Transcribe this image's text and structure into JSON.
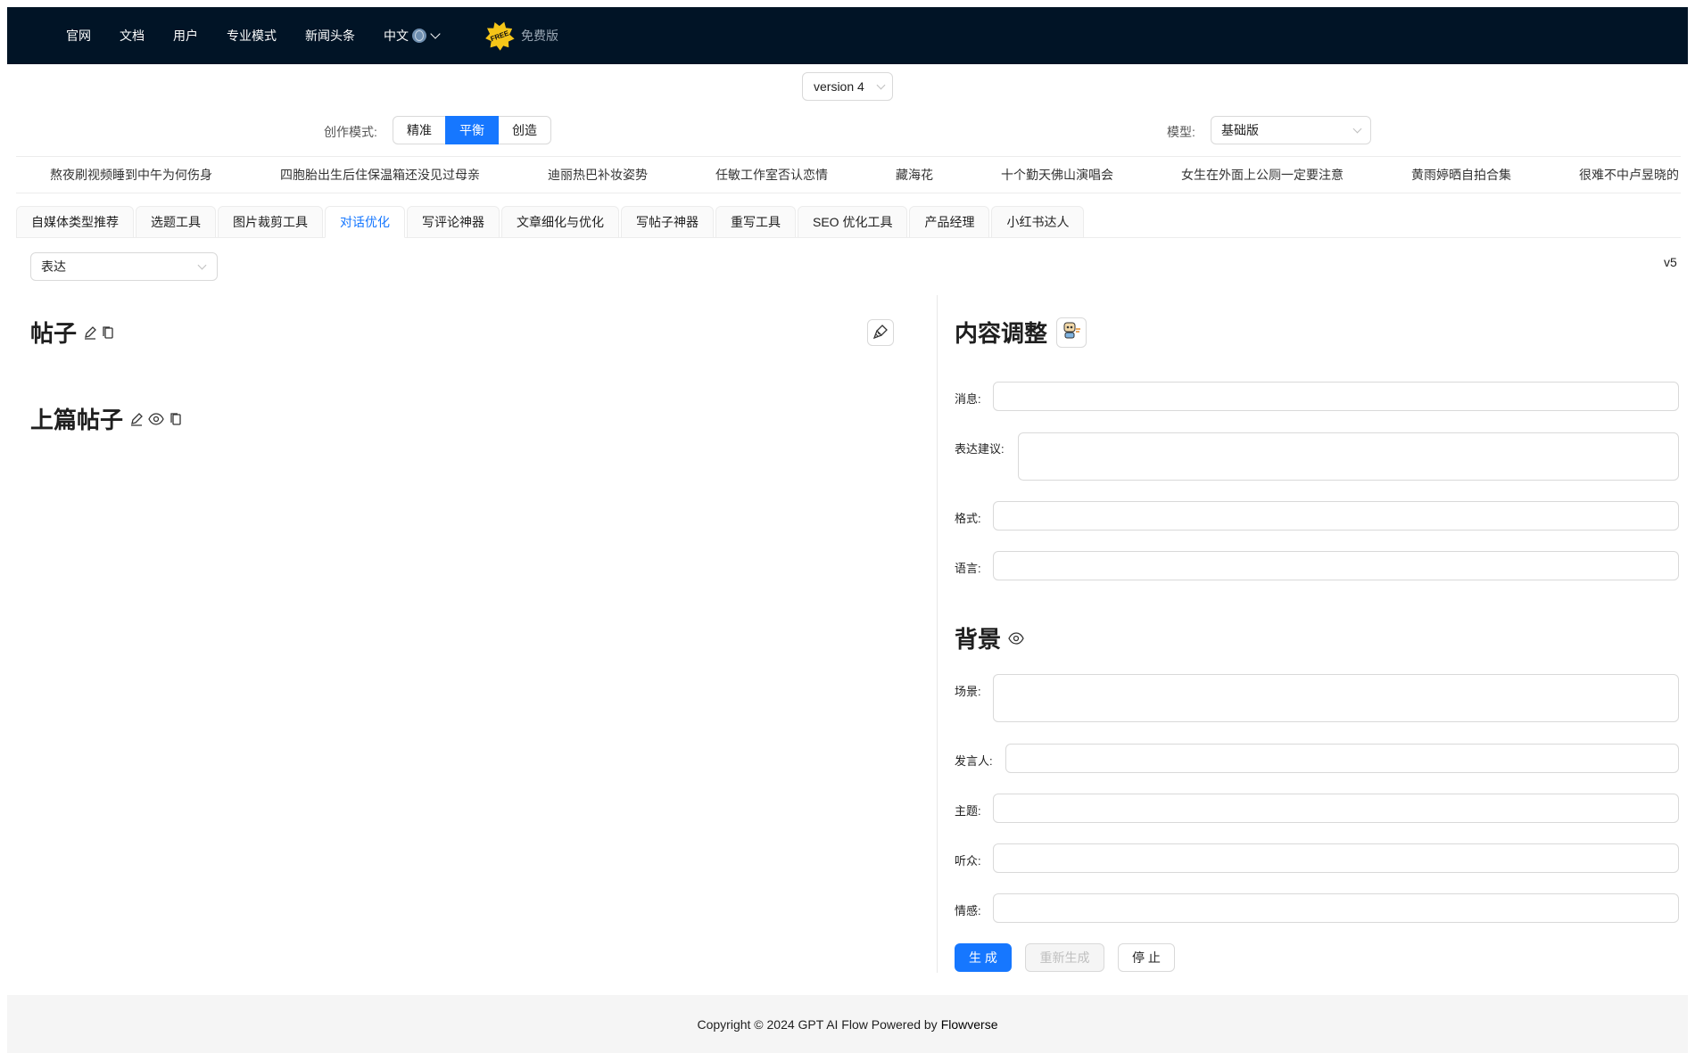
{
  "nav": {
    "items": [
      "官网",
      "文档",
      "用户",
      "专业模式",
      "新闻头条"
    ],
    "language": "中文",
    "free_badge_text": "FREE",
    "free_label": "免费版"
  },
  "version": {
    "selected": "version 4"
  },
  "mode": {
    "label": "创作模式:",
    "options": [
      "精准",
      "平衡",
      "创造"
    ],
    "selected": "平衡"
  },
  "model": {
    "label": "模型:",
    "selected": "基础版"
  },
  "headlines": [
    "熬夜刷视频睡到中午为何伤身",
    "四胞胎出生后住保温箱还没见过母亲",
    "迪丽热巴补妆姿势",
    "任敏工作室否认恋情",
    "藏海花",
    "十个勤天佛山演唱会",
    "女生在外面上公厕一定要注意",
    "黄雨婷晒自拍合集",
    "很难不中卢昱晓的"
  ],
  "tabs": {
    "items": [
      "自媒体类型推荐",
      "选题工具",
      "图片裁剪工具",
      "对话优化",
      "写评论神器",
      "文章细化与优化",
      "写帖子神器",
      "重写工具",
      "SEO 优化工具",
      "产品经理",
      "小红书达人"
    ],
    "active": "对话优化"
  },
  "sub_select": {
    "selected": "表达"
  },
  "version_tag": "v5",
  "left": {
    "post_title": "帖子",
    "prev_post_title": "上篇帖子"
  },
  "right": {
    "content_title": "内容调整",
    "fields": {
      "message": "消息:",
      "suggestion": "表达建议:",
      "format": "格式:",
      "language": "语言:"
    },
    "background_title": "背景",
    "bg_fields": {
      "scene": "场景:",
      "speaker": "发言人:",
      "topic": "主题:",
      "audience": "听众:",
      "emotion": "情感:"
    },
    "buttons": {
      "generate": "生 成",
      "regenerate": "重新生成",
      "stop": "停 止"
    }
  },
  "footer": {
    "text": "Copyright © 2024 GPT AI Flow Powered by",
    "brand": "Flowverse"
  }
}
